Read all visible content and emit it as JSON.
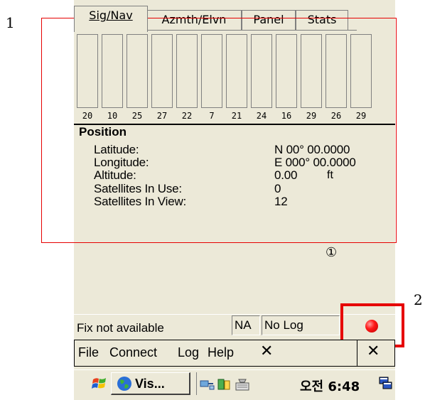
{
  "tabs": [
    {
      "label": "Sig/Nav"
    },
    {
      "label": "Azmth/Elvn"
    },
    {
      "label": "Panel"
    },
    {
      "label": "Stats"
    }
  ],
  "satellite_ids": [
    "20",
    "10",
    "25",
    "27",
    "22",
    "7",
    "21",
    "24",
    "16",
    "29",
    "26",
    "29"
  ],
  "position": {
    "title": "Position",
    "latitude_label": "Latitude:",
    "latitude_value": "N 00° 00.0000",
    "longitude_label": "Longitude:",
    "longitude_value": "E 000° 00.0000",
    "altitude_label": "Altitude:",
    "altitude_value": "0.00",
    "altitude_unit": "ft",
    "sats_in_use_label": "Satellites In Use:",
    "sats_in_use_value": "0",
    "sats_in_view_label": "Satellites In View:",
    "sats_in_view_value": "12"
  },
  "annotations": {
    "label_1": "1",
    "label_2": "2",
    "circled_1": "①"
  },
  "status": {
    "fix_text": "Fix not available",
    "mode": "NA",
    "log_status": "No Log",
    "indicator_color": "#ff1a1a"
  },
  "menu": {
    "items": [
      "File",
      "Connect",
      "Log",
      "Help"
    ],
    "close_glyph": "✕",
    "window_close_glyph": "✕"
  },
  "taskbar": {
    "task_label": "Vis...",
    "clock": "오전 6:48"
  },
  "colors": {
    "annotation_red": "#e60000",
    "panel_bg": "#ece9d8"
  },
  "icons": [
    "windows-flag-icon",
    "globe-icon",
    "network-icon",
    "battery-icon",
    "keyboard-icon",
    "desktop-icon"
  ]
}
